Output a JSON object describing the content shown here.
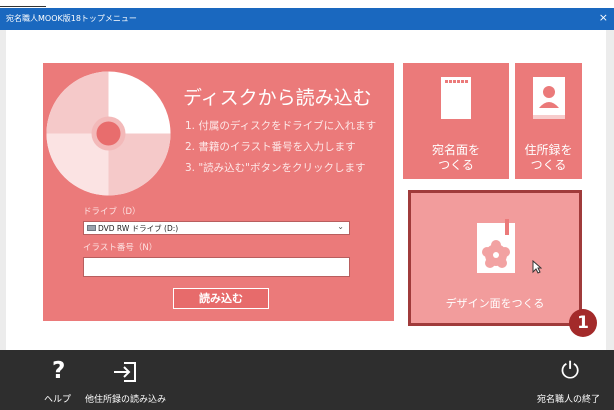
{
  "window": {
    "title": "宛名職人MOOK版18トップメニュー",
    "close_glyph": "×",
    "title_color": "#1a68bf"
  },
  "disk_panel": {
    "heading": "ディスクから読み込む",
    "steps": [
      "1. 付属のディスクをドライブに入れます",
      "2. 書籍のイラスト番号を入力します",
      "3. \"読み込む\"ボタンをクリックします"
    ],
    "drive_label": "ドライブ（D）",
    "drive_value": "DVD RW ドライブ (D:)",
    "illust_label": "イラスト番号（N）",
    "illust_value": "",
    "read_button": "読み込む",
    "color": "#eb7a7a"
  },
  "tiles": {
    "atena": {
      "line1": "宛名面を",
      "line2": "つくる",
      "icon": "card-icon"
    },
    "jusho": {
      "line1": "住所録を",
      "line2": "つくる",
      "icon": "address-book-icon"
    },
    "design": {
      "label": "デザイン面をつくる",
      "icon": "plum-flower-card-icon",
      "badge": "1"
    }
  },
  "bottom_bar": {
    "help_glyph": "?",
    "help": "ヘルプ",
    "import": "他住所録の読み込み",
    "exit_glyph": "⏻",
    "exit": "宛名職人の終了"
  }
}
